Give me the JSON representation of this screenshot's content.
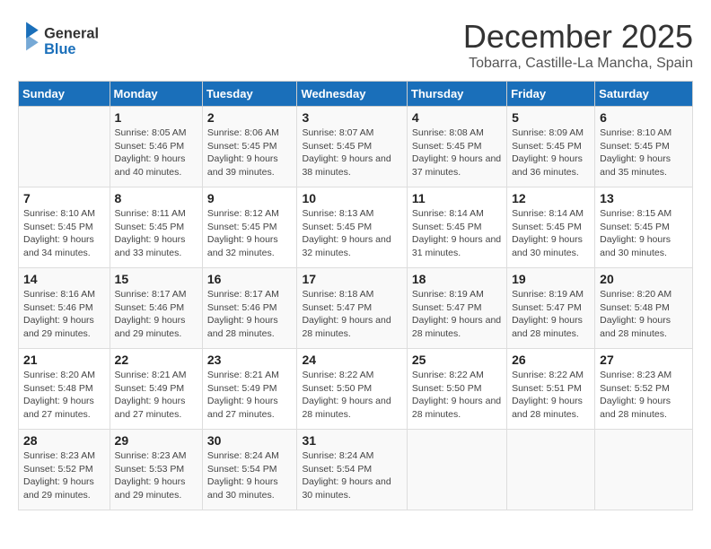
{
  "header": {
    "logo_general": "General",
    "logo_blue": "Blue",
    "month_title": "December 2025",
    "subtitle": "Tobarra, Castille-La Mancha, Spain"
  },
  "days_of_week": [
    "Sunday",
    "Monday",
    "Tuesday",
    "Wednesday",
    "Thursday",
    "Friday",
    "Saturday"
  ],
  "weeks": [
    [
      {
        "day": "",
        "info": ""
      },
      {
        "day": "1",
        "info": "Sunrise: 8:05 AM\nSunset: 5:46 PM\nDaylight: 9 hours\nand 40 minutes."
      },
      {
        "day": "2",
        "info": "Sunrise: 8:06 AM\nSunset: 5:45 PM\nDaylight: 9 hours\nand 39 minutes."
      },
      {
        "day": "3",
        "info": "Sunrise: 8:07 AM\nSunset: 5:45 PM\nDaylight: 9 hours\nand 38 minutes."
      },
      {
        "day": "4",
        "info": "Sunrise: 8:08 AM\nSunset: 5:45 PM\nDaylight: 9 hours\nand 37 minutes."
      },
      {
        "day": "5",
        "info": "Sunrise: 8:09 AM\nSunset: 5:45 PM\nDaylight: 9 hours\nand 36 minutes."
      },
      {
        "day": "6",
        "info": "Sunrise: 8:10 AM\nSunset: 5:45 PM\nDaylight: 9 hours\nand 35 minutes."
      }
    ],
    [
      {
        "day": "7",
        "info": "Sunrise: 8:10 AM\nSunset: 5:45 PM\nDaylight: 9 hours\nand 34 minutes."
      },
      {
        "day": "8",
        "info": "Sunrise: 8:11 AM\nSunset: 5:45 PM\nDaylight: 9 hours\nand 33 minutes."
      },
      {
        "day": "9",
        "info": "Sunrise: 8:12 AM\nSunset: 5:45 PM\nDaylight: 9 hours\nand 32 minutes."
      },
      {
        "day": "10",
        "info": "Sunrise: 8:13 AM\nSunset: 5:45 PM\nDaylight: 9 hours\nand 32 minutes."
      },
      {
        "day": "11",
        "info": "Sunrise: 8:14 AM\nSunset: 5:45 PM\nDaylight: 9 hours\nand 31 minutes."
      },
      {
        "day": "12",
        "info": "Sunrise: 8:14 AM\nSunset: 5:45 PM\nDaylight: 9 hours\nand 30 minutes."
      },
      {
        "day": "13",
        "info": "Sunrise: 8:15 AM\nSunset: 5:45 PM\nDaylight: 9 hours\nand 30 minutes."
      }
    ],
    [
      {
        "day": "14",
        "info": "Sunrise: 8:16 AM\nSunset: 5:46 PM\nDaylight: 9 hours\nand 29 minutes."
      },
      {
        "day": "15",
        "info": "Sunrise: 8:17 AM\nSunset: 5:46 PM\nDaylight: 9 hours\nand 29 minutes."
      },
      {
        "day": "16",
        "info": "Sunrise: 8:17 AM\nSunset: 5:46 PM\nDaylight: 9 hours\nand 28 minutes."
      },
      {
        "day": "17",
        "info": "Sunrise: 8:18 AM\nSunset: 5:47 PM\nDaylight: 9 hours\nand 28 minutes."
      },
      {
        "day": "18",
        "info": "Sunrise: 8:19 AM\nSunset: 5:47 PM\nDaylight: 9 hours\nand 28 minutes."
      },
      {
        "day": "19",
        "info": "Sunrise: 8:19 AM\nSunset: 5:47 PM\nDaylight: 9 hours\nand 28 minutes."
      },
      {
        "day": "20",
        "info": "Sunrise: 8:20 AM\nSunset: 5:48 PM\nDaylight: 9 hours\nand 28 minutes."
      }
    ],
    [
      {
        "day": "21",
        "info": "Sunrise: 8:20 AM\nSunset: 5:48 PM\nDaylight: 9 hours\nand 27 minutes."
      },
      {
        "day": "22",
        "info": "Sunrise: 8:21 AM\nSunset: 5:49 PM\nDaylight: 9 hours\nand 27 minutes."
      },
      {
        "day": "23",
        "info": "Sunrise: 8:21 AM\nSunset: 5:49 PM\nDaylight: 9 hours\nand 27 minutes."
      },
      {
        "day": "24",
        "info": "Sunrise: 8:22 AM\nSunset: 5:50 PM\nDaylight: 9 hours\nand 28 minutes."
      },
      {
        "day": "25",
        "info": "Sunrise: 8:22 AM\nSunset: 5:50 PM\nDaylight: 9 hours\nand 28 minutes."
      },
      {
        "day": "26",
        "info": "Sunrise: 8:22 AM\nSunset: 5:51 PM\nDaylight: 9 hours\nand 28 minutes."
      },
      {
        "day": "27",
        "info": "Sunrise: 8:23 AM\nSunset: 5:52 PM\nDaylight: 9 hours\nand 28 minutes."
      }
    ],
    [
      {
        "day": "28",
        "info": "Sunrise: 8:23 AM\nSunset: 5:52 PM\nDaylight: 9 hours\nand 29 minutes."
      },
      {
        "day": "29",
        "info": "Sunrise: 8:23 AM\nSunset: 5:53 PM\nDaylight: 9 hours\nand 29 minutes."
      },
      {
        "day": "30",
        "info": "Sunrise: 8:24 AM\nSunset: 5:54 PM\nDaylight: 9 hours\nand 30 minutes."
      },
      {
        "day": "31",
        "info": "Sunrise: 8:24 AM\nSunset: 5:54 PM\nDaylight: 9 hours\nand 30 minutes."
      },
      {
        "day": "",
        "info": ""
      },
      {
        "day": "",
        "info": ""
      },
      {
        "day": "",
        "info": ""
      }
    ]
  ]
}
